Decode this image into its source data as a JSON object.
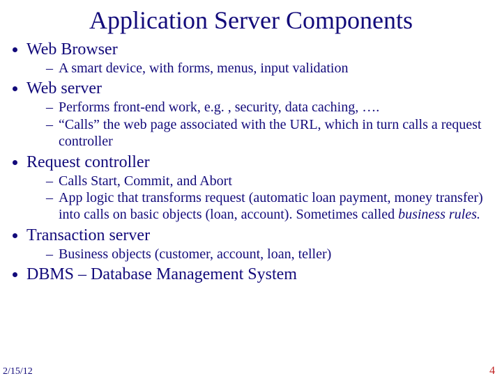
{
  "title": "Application Server Components",
  "bullets": [
    {
      "label": "Web Browser",
      "subs": [
        " A smart device, with forms, menus, input validation"
      ]
    },
    {
      "label": "Web server",
      "subs": [
        "Performs front-end work, e.g. , security, data caching, ….",
        "“Calls” the web page associated with the URL, which in turn calls a request controller"
      ]
    },
    {
      "label": "Request controller",
      "subs": [
        "Calls Start, Commit, and Abort",
        "App logic that transforms request (automatic loan payment, money transfer) into calls on basic objects (loan, account). Sometimes called <em class=\"bi\">business rules.</em>"
      ]
    },
    {
      "label": "Transaction server",
      "subs": [
        "Business objects (customer, account, loan, teller)"
      ]
    },
    {
      "label": "DBMS – Database Management System",
      "subs": []
    }
  ],
  "footer": {
    "date": "2/15/12",
    "page": "4"
  }
}
